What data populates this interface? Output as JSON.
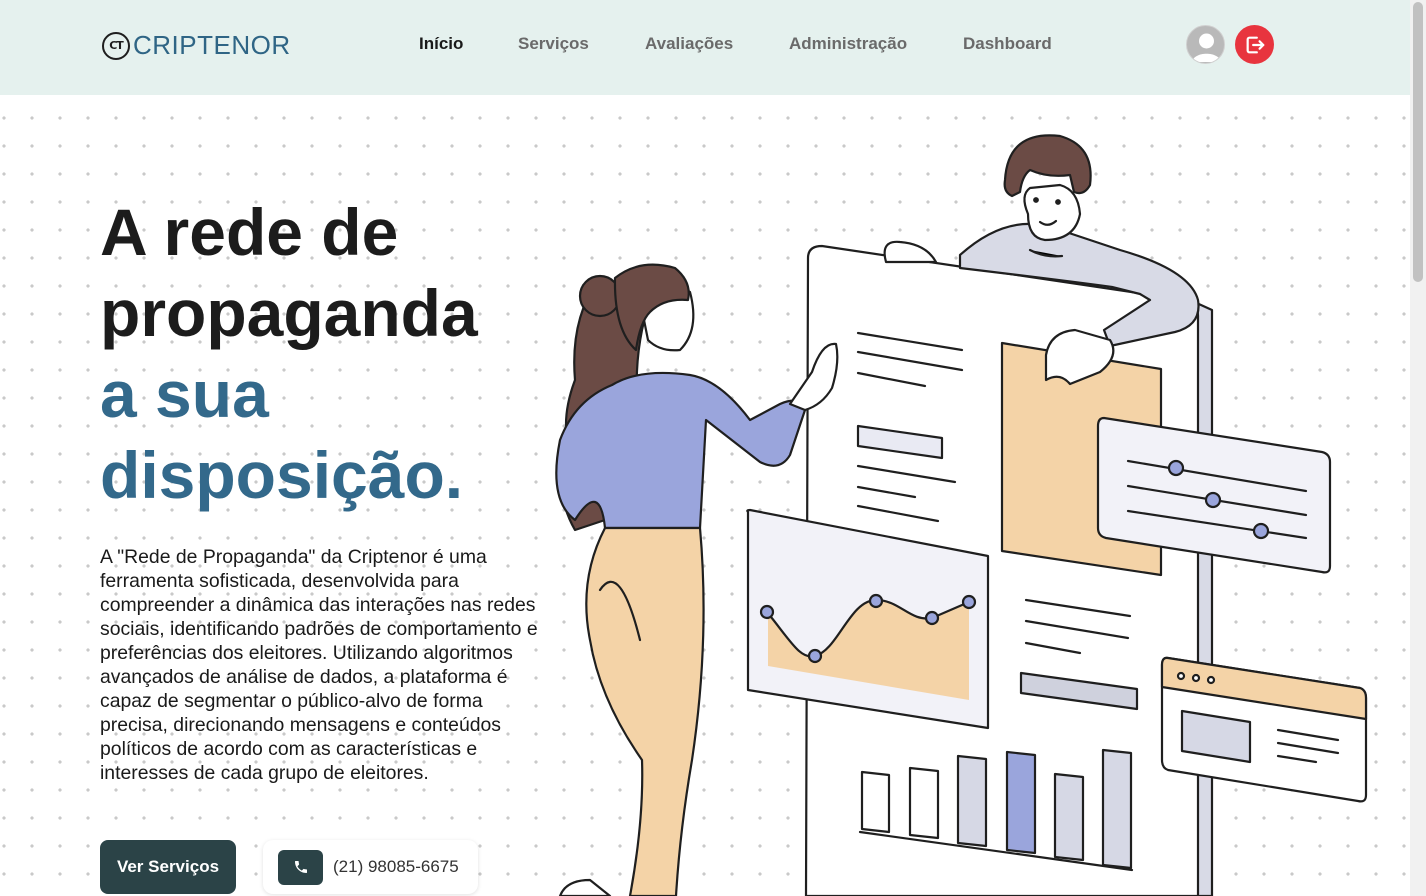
{
  "brand": {
    "mark": "CT",
    "name": "CRIPTENOR"
  },
  "nav": {
    "items": [
      {
        "label": "Início",
        "active": true
      },
      {
        "label": "Serviços",
        "active": false
      },
      {
        "label": "Avaliações",
        "active": false
      },
      {
        "label": "Administração",
        "active": false
      },
      {
        "label": "Dashboard",
        "active": false
      }
    ]
  },
  "header_icons": {
    "profile": "user-avatar-icon",
    "logout": "logout-icon"
  },
  "hero": {
    "title_line1": "A rede de",
    "title_line2": "propaganda",
    "title_line3": "a sua",
    "title_line4": "disposição.",
    "description": "A \"Rede de Propaganda\" da Criptenor é uma ferramenta sofisticada, desenvolvida para compreender a dinâmica das interações nas redes sociais, identificando padrões de comportamento e preferências dos eleitores. Utilizando algoritmos avançados de análise de dados, a plataforma é capaz de segmentar o público-alvo de forma precisa, direcionando mensagens e conteúdos políticos de acordo com as características e interesses de cada grupo de eleitores.",
    "cta_label": "Ver Serviços",
    "phone": "(21) 98085-6675"
  },
  "colors": {
    "header_bg": "#e5f1ee",
    "brand_blue": "#33698b",
    "button_dark": "#2b4347",
    "logout_red": "#e8343e"
  }
}
